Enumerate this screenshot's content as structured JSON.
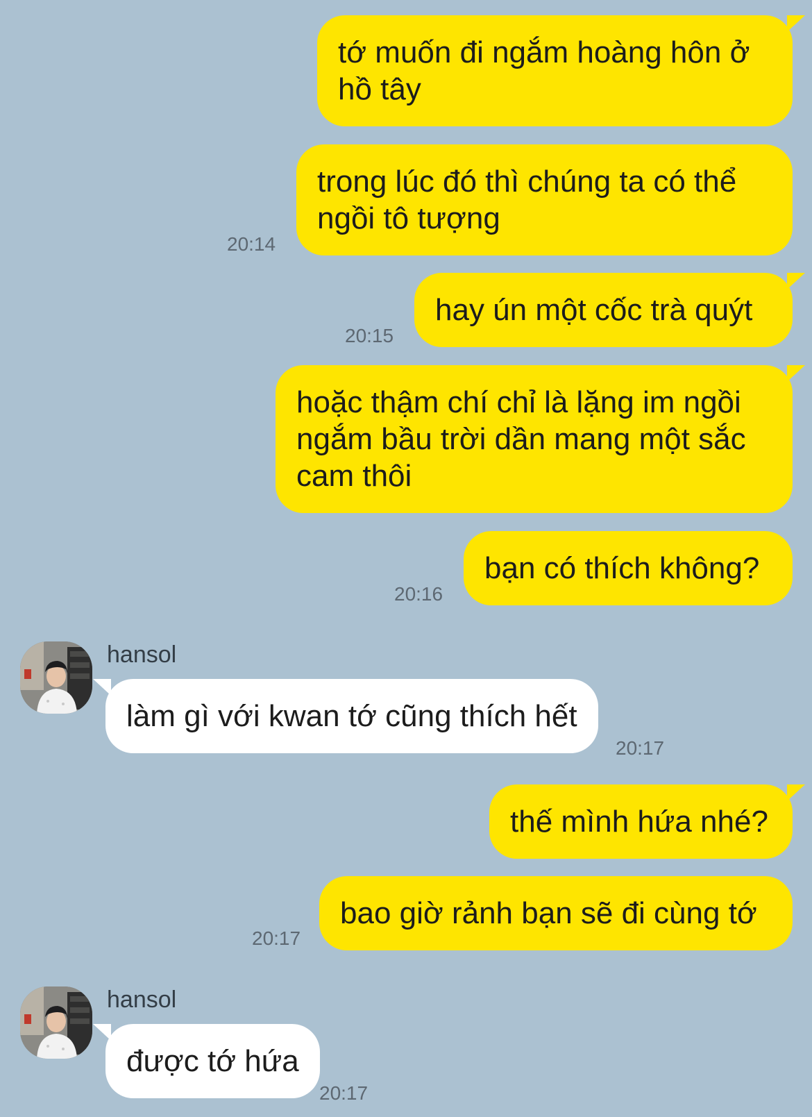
{
  "messages": [
    {
      "text": "tớ muốn đi ngắm hoàng hôn ở\nhồ tây"
    },
    {
      "text": "trong lúc đó thì chúng ta có thể\nngồi tô tượng",
      "time": "20:14"
    },
    {
      "text": "hay ún một cốc trà quýt",
      "time": "20:15"
    },
    {
      "text": "hoặc thậm chí chỉ là lặng im ngồi\nngắm bầu trời dần mang một sắc\ncam thôi"
    },
    {
      "text": "bạn có thích không?",
      "time": "20:16"
    },
    {
      "sender": "hansol",
      "text": "làm gì với kwan tớ cũng thích hết",
      "time": "20:17"
    },
    {
      "text": "thế mình hứa nhé?"
    },
    {
      "text": "bao giờ rảnh bạn sẽ đi cùng tớ",
      "time": "20:17"
    },
    {
      "sender": "hansol",
      "text": "được tớ hứa",
      "time": "20:17"
    }
  ],
  "colors": {
    "background": "#abc1d1",
    "outgoing_bubble": "#fee500",
    "incoming_bubble": "#ffffff"
  },
  "icons": {
    "avatar": "profile-photo"
  }
}
